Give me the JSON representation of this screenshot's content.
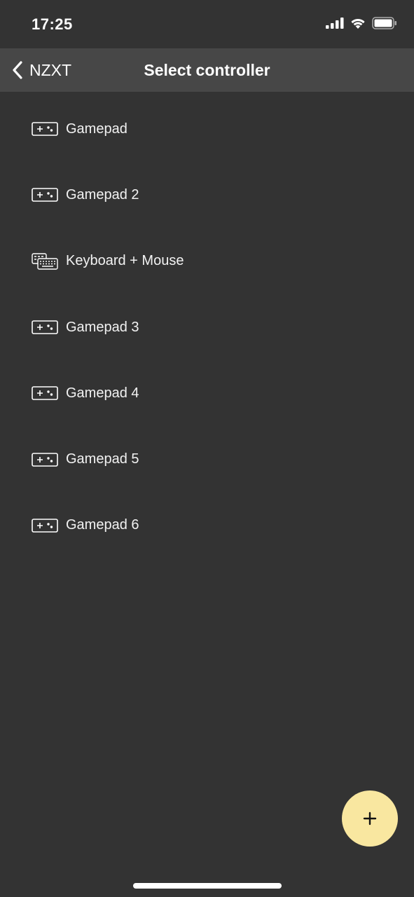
{
  "status_bar": {
    "time": "17:25"
  },
  "nav": {
    "back_label": "NZXT",
    "title": "Select controller"
  },
  "controllers": [
    {
      "label": "Gamepad",
      "icon": "gamepad-icon"
    },
    {
      "label": "Gamepad 2",
      "icon": "gamepad-icon"
    },
    {
      "label": "Keyboard + Mouse",
      "icon": "keyboard-mouse-icon"
    },
    {
      "label": "Gamepad 3",
      "icon": "gamepad-icon"
    },
    {
      "label": "Gamepad 4",
      "icon": "gamepad-icon"
    },
    {
      "label": "Gamepad 5",
      "icon": "gamepad-icon"
    },
    {
      "label": "Gamepad 6",
      "icon": "gamepad-icon"
    }
  ],
  "fab": {
    "icon": "plus-icon"
  },
  "colors": {
    "background": "#333333",
    "nav_background": "#474747",
    "fab": "#f9e7a0",
    "text": "#ffffff"
  }
}
